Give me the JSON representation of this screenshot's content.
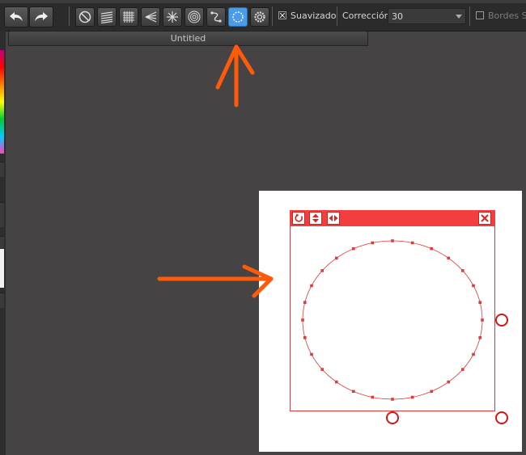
{
  "toolbar": {
    "undo_icon": "undo-arrow-icon",
    "redo_icon": "redo-arrow-icon",
    "tools": [
      {
        "icon": "no-symmetry-icon"
      },
      {
        "icon": "parallel-lines-icon"
      },
      {
        "icon": "grid-icon"
      },
      {
        "icon": "perspective-icon"
      },
      {
        "icon": "radial-icon"
      },
      {
        "icon": "concentric-circles-icon"
      },
      {
        "icon": "curve-ruler-icon"
      },
      {
        "icon": "ellipse-ruler-icon",
        "active": true
      },
      {
        "icon": "settings-gear-icon"
      }
    ],
    "smooth_label": "Suavizado",
    "smooth_checked": true,
    "correction_label": "Corrección",
    "correction_value": "30",
    "soft_edges_label": "Bordes Su",
    "soft_edges_checked": false
  },
  "document": {
    "tab_title": "Untitled"
  },
  "selection_box": {
    "buttons": [
      {
        "icon": "rotate-icon"
      },
      {
        "icon": "flip-vertical-icon"
      },
      {
        "icon": "flip-horizontal-icon"
      }
    ],
    "close_icon": "close-icon"
  },
  "colors": {
    "accent_red": "#f23e3e",
    "annotation_orange": "#ff5a0a",
    "active_tool": "#4a9be8",
    "workspace": "#454343"
  }
}
